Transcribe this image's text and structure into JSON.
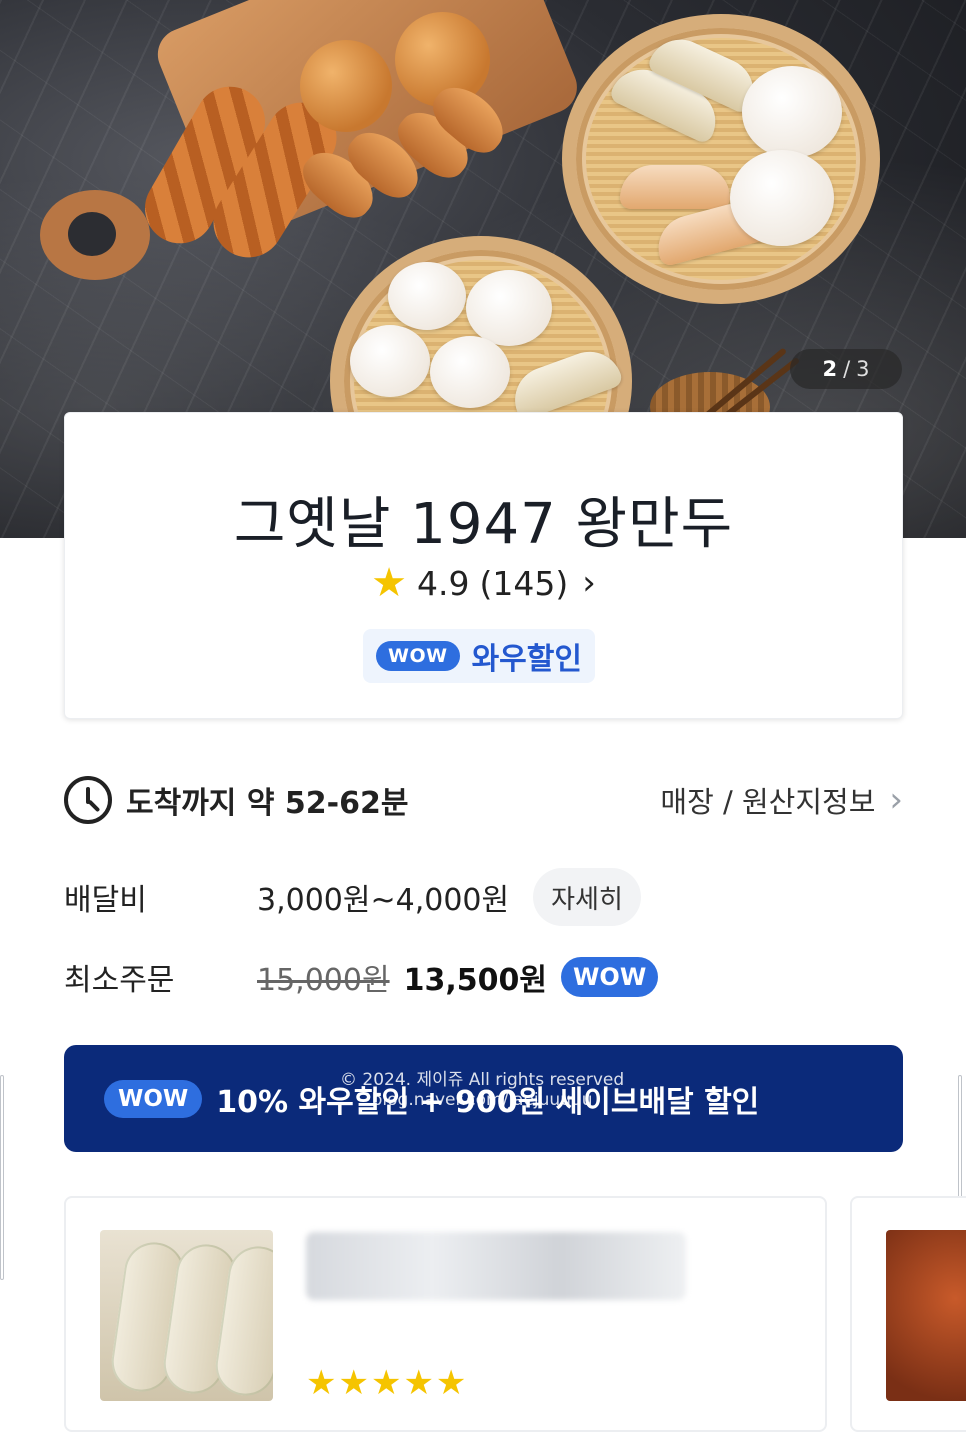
{
  "hero": {
    "image_counter": {
      "current": "2",
      "separator": "/",
      "total": "3"
    }
  },
  "store": {
    "name": "그옛날 1947 왕만두",
    "rating": "4.9",
    "review_count": "(145)",
    "wow_badge": "WOW",
    "wow_discount_label": "와우할인"
  },
  "delivery": {
    "time_label": "도착까지 약 52-62분",
    "store_info_link": "매장 / 원산지정보"
  },
  "fees": {
    "delivery_fee_label": "배달비",
    "delivery_fee_value": "3,000원~4,000원",
    "detail_button": "자세히",
    "min_order_label": "최소주문",
    "min_order_original": "15,000원",
    "min_order_discounted": "13,500원",
    "min_order_badge": "WOW"
  },
  "promo": {
    "badge": "WOW",
    "text": "10% 와우할인 + 900원 세이브배달 할인"
  },
  "watermark": {
    "line1": "© 2024. 제이쥬 All rights reserved",
    "line2": "blog.naver.com/jaejuuuuu"
  },
  "reviews": [
    {
      "rating_stars": "★★★★★"
    }
  ],
  "colors": {
    "accent_blue": "#2e6edf",
    "banner_navy": "#0b2a7a",
    "star_yellow": "#f5c400"
  }
}
